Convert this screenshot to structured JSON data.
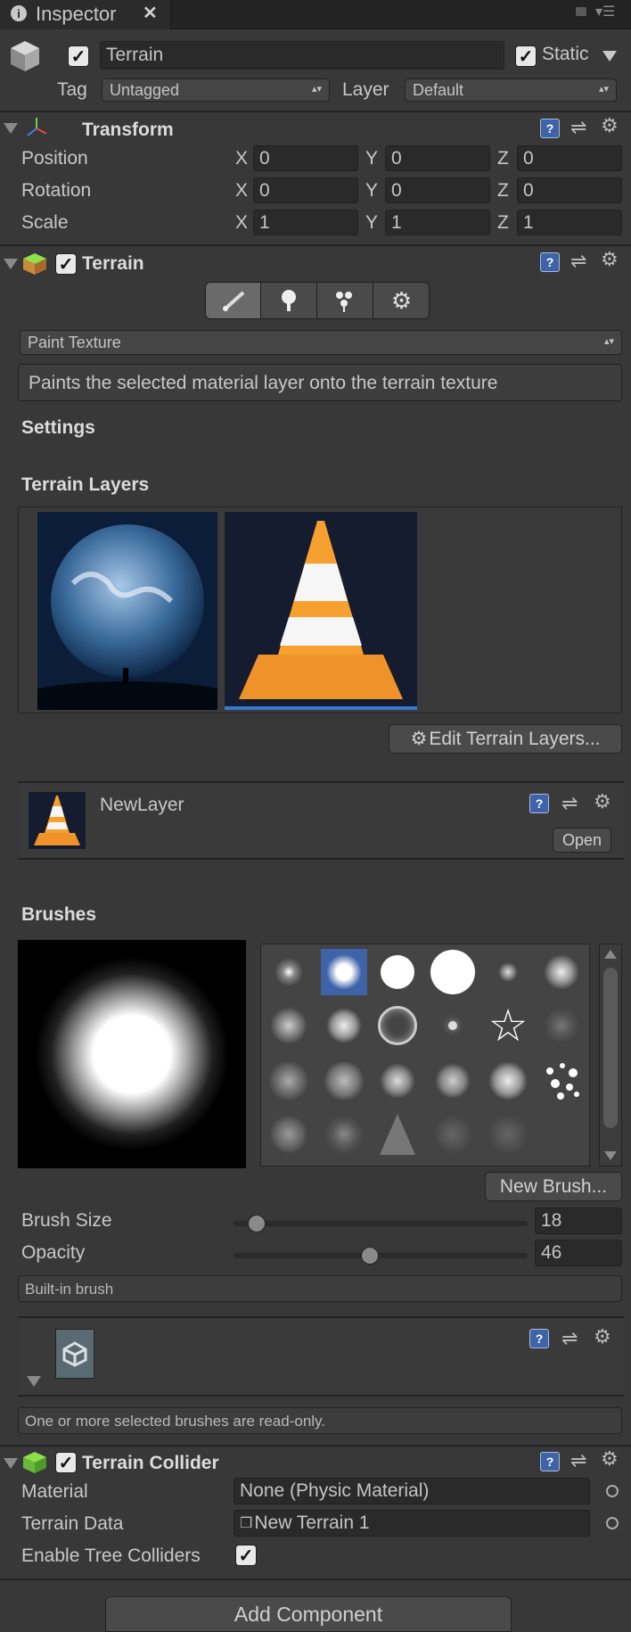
{
  "tab": {
    "title": "Inspector"
  },
  "object": {
    "name": "Terrain",
    "static_label": "Static",
    "tag_label": "Tag",
    "tag_value": "Untagged",
    "layer_label": "Layer",
    "layer_value": "Default"
  },
  "transform": {
    "title": "Transform",
    "rows": [
      {
        "label": "Position",
        "x": "0",
        "y": "0",
        "z": "0"
      },
      {
        "label": "Rotation",
        "x": "0",
        "y": "0",
        "z": "0"
      },
      {
        "label": "Scale",
        "x": "1",
        "y": "1",
        "z": "1"
      }
    ],
    "axis_x": "X",
    "axis_y": "Y",
    "axis_z": "Z"
  },
  "terrain": {
    "title": "Terrain",
    "tool_dropdown": "Paint Texture",
    "tool_description": "Paints the selected material layer onto the terrain texture",
    "settings_label": "Settings",
    "layers_label": "Terrain Layers",
    "edit_layers_button": "Edit Terrain Layers...",
    "layer_name": "NewLayer",
    "open_button": "Open",
    "brushes_label": "Brushes",
    "new_brush_button": "New Brush...",
    "brush_size_label": "Brush Size",
    "brush_size_value": "18",
    "brush_size_fraction": 0.05,
    "opacity_label": "Opacity",
    "opacity_value": "46",
    "opacity_fraction": 0.46,
    "builtin_label": "Built-in brush",
    "readonly_label": "One or more selected brushes are read-only."
  },
  "collider": {
    "title": "Terrain Collider",
    "material_label": "Material",
    "material_value": "None (Physic Material)",
    "data_label": "Terrain Data",
    "data_value": "New Terrain 1",
    "trees_label": "Enable Tree Colliders"
  },
  "add_component_button": "Add Component",
  "colors": {
    "background": "#383838",
    "accent": "#3f63a8",
    "header_dark": "#232323"
  }
}
